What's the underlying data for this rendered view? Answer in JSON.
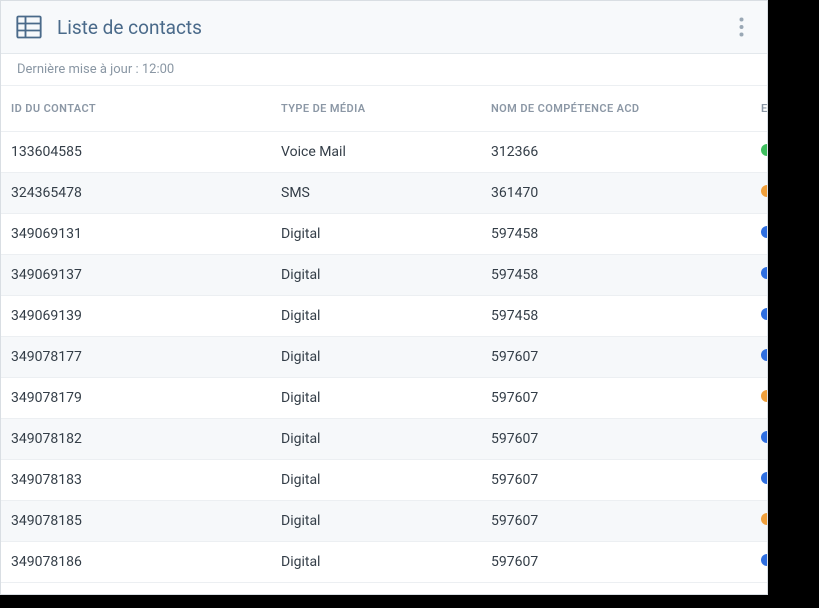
{
  "header": {
    "title": "Liste de contacts"
  },
  "subheader": {
    "text": "Dernière mise à jour : 12:00"
  },
  "columns": {
    "id": "ID DU CONTACT",
    "media": "TYPE DE MÉDIA",
    "skill": "NOM DE COMPÉTENCE ACD",
    "status": "E"
  },
  "rows": [
    {
      "id": "133604585",
      "media": "Voice Mail",
      "skill": "312366",
      "status": "green"
    },
    {
      "id": "324365478",
      "media": "SMS",
      "skill": "361470",
      "status": "orange"
    },
    {
      "id": "349069131",
      "media": "Digital",
      "skill": "597458",
      "status": "blue"
    },
    {
      "id": "349069137",
      "media": "Digital",
      "skill": "597458",
      "status": "blue"
    },
    {
      "id": "349069139",
      "media": "Digital",
      "skill": "597458",
      "status": "blue"
    },
    {
      "id": "349078177",
      "media": "Digital",
      "skill": "597607",
      "status": "blue"
    },
    {
      "id": "349078179",
      "media": "Digital",
      "skill": "597607",
      "status": "orange"
    },
    {
      "id": "349078182",
      "media": "Digital",
      "skill": "597607",
      "status": "blue"
    },
    {
      "id": "349078183",
      "media": "Digital",
      "skill": "597607",
      "status": "blue"
    },
    {
      "id": "349078185",
      "media": "Digital",
      "skill": "597607",
      "status": "orange"
    },
    {
      "id": "349078186",
      "media": "Digital",
      "skill": "597607",
      "status": "blue"
    }
  ]
}
